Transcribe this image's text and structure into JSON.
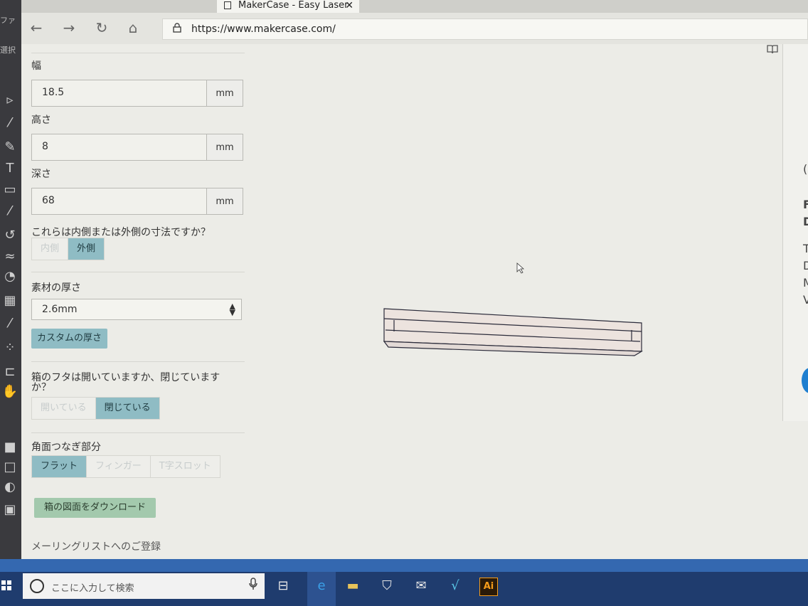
{
  "tab": {
    "title": "MakerCase - Easy Laser",
    "close": "✕"
  },
  "nav": {
    "back": "←",
    "forward": "→",
    "refresh": "↻",
    "home": "⌂",
    "url": "https://www.makercase.com/",
    "lock": "🔒"
  },
  "toolbar_right": {
    "reading": "📖",
    "star": "☆"
  },
  "left_app": {
    "label1": "ファ",
    "label2": "選択"
  },
  "form": {
    "width": {
      "label": "幅",
      "value": "18.5",
      "unit": "mm"
    },
    "height": {
      "label": "高さ",
      "value": "8",
      "unit": "mm"
    },
    "depth": {
      "label": "深さ",
      "value": "68",
      "unit": "mm"
    },
    "dimension_question": "これらは内側または外側の寸法ですか？",
    "dimension_options": [
      "内側",
      "外側"
    ],
    "dimension_selected": "外側",
    "material_label": "素材の厚さ",
    "material_value": "2.6mm",
    "custom_thickness": "カスタムの厚さ",
    "lid_question": "箱のフタは開いていますか、閉じていますか？",
    "lid_options": [
      "開いている",
      "閉じている"
    ],
    "lid_selected": "閉じている",
    "edge_label": "角面つなぎ部分",
    "edge_options": [
      "フラット",
      "フィンガー",
      "T字スロット"
    ],
    "edge_selected": "フラット",
    "download": "箱の図面をダウンロード",
    "mailing": "メーリングリストへのご登録"
  },
  "right_panel": {
    "letters": [
      "(",
      "F",
      "D",
      "T",
      "D",
      "M",
      "V"
    ]
  },
  "taskbar": {
    "search_placeholder": "ここに入力して検索",
    "mic": "🎙",
    "ai": "Ai"
  }
}
